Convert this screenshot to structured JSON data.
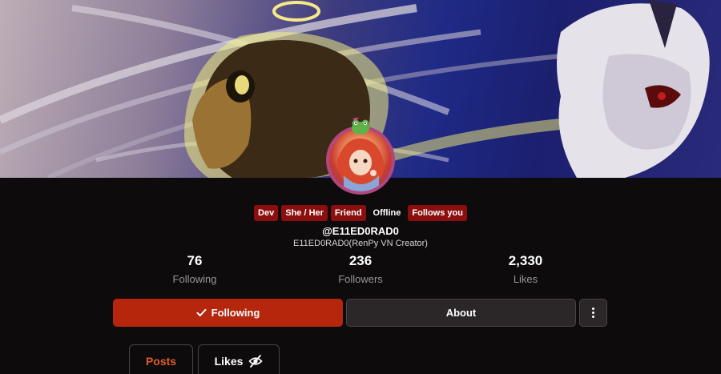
{
  "profile": {
    "tags": [
      {
        "label": "Dev",
        "style": "red"
      },
      {
        "label": "She / Her",
        "style": "red"
      },
      {
        "label": "Friend",
        "style": "red"
      },
      {
        "label": "Offline",
        "style": "plain"
      },
      {
        "label": "Follows you",
        "style": "red"
      }
    ],
    "handle": "@E11ED0RAD0",
    "display_name": "E11ED0RAD0(RenPy VN Creator)"
  },
  "stats": [
    {
      "value": "76",
      "label": "Following"
    },
    {
      "value": "236",
      "label": "Followers"
    },
    {
      "value": "2,330",
      "label": "Likes"
    }
  ],
  "actions": {
    "following_label": "Following",
    "about_label": "About"
  },
  "tabs": [
    {
      "label": "Posts",
      "active": true
    },
    {
      "label": "Likes",
      "active": false
    }
  ],
  "colors": {
    "accent": "#b5260d",
    "active_tab": "#e35a2b",
    "tag_red": "#8c0f0f",
    "avatar_ring": "#b2467f"
  },
  "icons": {
    "following": "check-icon",
    "likes_tab": "eye-slash-icon",
    "more": "vertical-dots-icon"
  }
}
